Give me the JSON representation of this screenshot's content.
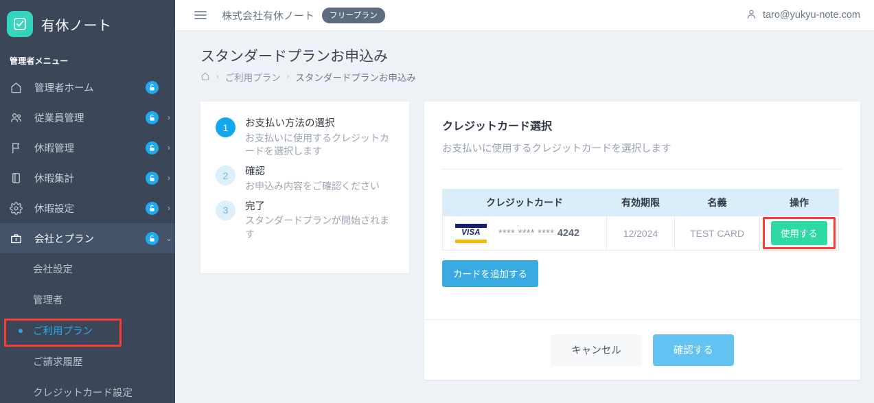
{
  "sidebar": {
    "brand": {
      "title": "有休ノート",
      "logo_icon": "checkbox-check-icon"
    },
    "menu_caption": "管理者メニュー",
    "items": [
      {
        "label": "管理者ホーム",
        "icon": "home-icon",
        "lock": true,
        "chevron": ""
      },
      {
        "label": "従業員管理",
        "icon": "users-icon",
        "lock": true,
        "chevron": "›"
      },
      {
        "label": "休暇管理",
        "icon": "flag-icon",
        "lock": true,
        "chevron": "›"
      },
      {
        "label": "休暇集計",
        "icon": "book-icon",
        "lock": true,
        "chevron": "›"
      },
      {
        "label": "休暇設定",
        "icon": "gear-icon",
        "lock": true,
        "chevron": "›"
      },
      {
        "label": "会社とプラン",
        "icon": "briefcase-icon",
        "lock": true,
        "chevron": "⌄",
        "active": true
      }
    ],
    "sub_items": [
      {
        "label": "会社設定",
        "current": false
      },
      {
        "label": "管理者",
        "current": false
      },
      {
        "label": "ご利用プラン",
        "current": true
      },
      {
        "label": "ご請求履歴",
        "current": false
      },
      {
        "label": "クレジットカード設定",
        "current": false
      }
    ],
    "highlight_color": "#fb3b34"
  },
  "topbar": {
    "menu_icon": "hamburger-icon",
    "company_name": "株式会社有休ノート",
    "plan_badge": "フリープラン",
    "user_icon": "user-icon",
    "user_email": "taro@yukyu-note.com"
  },
  "page": {
    "title": "スタンダードプランお申込み",
    "breadcrumb": {
      "home_icon": "home-icon",
      "separator": "›",
      "items": [
        "ご利用プラン",
        "スタンダードプランお申込み"
      ]
    }
  },
  "steps": [
    {
      "num": "1",
      "state": "done",
      "title": "お支払い方法の選択",
      "desc": "お支払いに使用するクレジットカードを選択します"
    },
    {
      "num": "2",
      "state": "todo",
      "title": "確認",
      "desc": "お申込み内容をご確認ください"
    },
    {
      "num": "3",
      "state": "todo",
      "title": "完了",
      "desc": "スタンダードプランが開始されます"
    }
  ],
  "select_panel": {
    "title": "クレジットカード選択",
    "subtitle": "お支払いに使用するクレジットカードを選択します",
    "table": {
      "headers": [
        "クレジットカード",
        "有効期限",
        "名義",
        "操作"
      ],
      "rows": [
        {
          "brand": "visa-logo-icon",
          "brand_text": "VISA",
          "masked": "**** **** ****",
          "last4": "4242",
          "expiry": "12/2024",
          "holder": "TEST CARD",
          "action_label": "使用する"
        }
      ]
    },
    "add_card_label": "カードを追加する",
    "cancel_label": "キャンセル",
    "confirm_label": "確認する"
  },
  "colors": {
    "sidebar_bg": "#3b4759",
    "accent_blue": "#12a8f0",
    "use_button_green": "#2fd9a5",
    "confirm_blue": "#62c3f3",
    "add_blue": "#39a9e2",
    "highlight_red": "#fb3b34",
    "table_header_bg": "#d9eefa"
  }
}
